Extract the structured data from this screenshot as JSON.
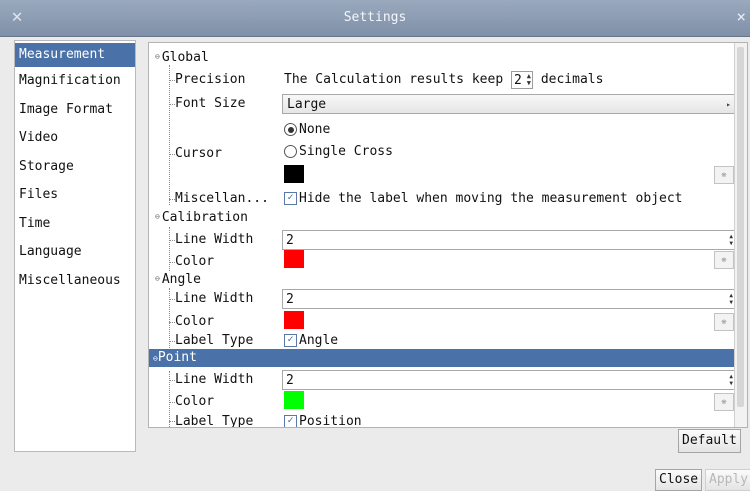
{
  "window": {
    "title": "Settings",
    "close_glyph": "×",
    "app_icon": "app-icon"
  },
  "sidebar": {
    "items": [
      {
        "label": "Measurement",
        "active": true
      },
      {
        "label": "Magnification"
      },
      {
        "label": "Image Format"
      },
      {
        "label": "Video"
      },
      {
        "label": "Storage"
      },
      {
        "label": "Files"
      },
      {
        "label": "Time"
      },
      {
        "label": "Language"
      },
      {
        "label": "Miscellaneous"
      }
    ]
  },
  "global": {
    "title": "Global",
    "precision_label": "Precision",
    "precision_prefix": "The Calculation results keep",
    "precision_value": "2",
    "precision_suffix": "decimals",
    "font_size_label": "Font Size",
    "font_size_value": "Large",
    "cursor_label": "Cursor",
    "cursor_options": [
      "None",
      "Single Cross"
    ],
    "cursor_selected": "None",
    "cursor_color": "#000000",
    "misc_label": "Miscellan...",
    "misc_checkbox": "Hide the label when moving the measurement object"
  },
  "calibration": {
    "title": "Calibration",
    "line_width_label": "Line Width",
    "line_width_value": "2",
    "color_label": "Color",
    "color": "#ff0000"
  },
  "angle": {
    "title": "Angle",
    "line_width_label": "Line Width",
    "line_width_value": "2",
    "color_label": "Color",
    "color": "#ff0000",
    "label_type_label": "Label Type",
    "label_type_value": "Angle"
  },
  "point": {
    "title": "Point",
    "line_width_label": "Line Width",
    "line_width_value": "2",
    "color_label": "Color",
    "color": "#00ff00",
    "label_type_label": "Label Type",
    "label_type_value": "Position"
  },
  "buttons": {
    "default": "Default",
    "close": "Close",
    "apply": "Apply"
  }
}
